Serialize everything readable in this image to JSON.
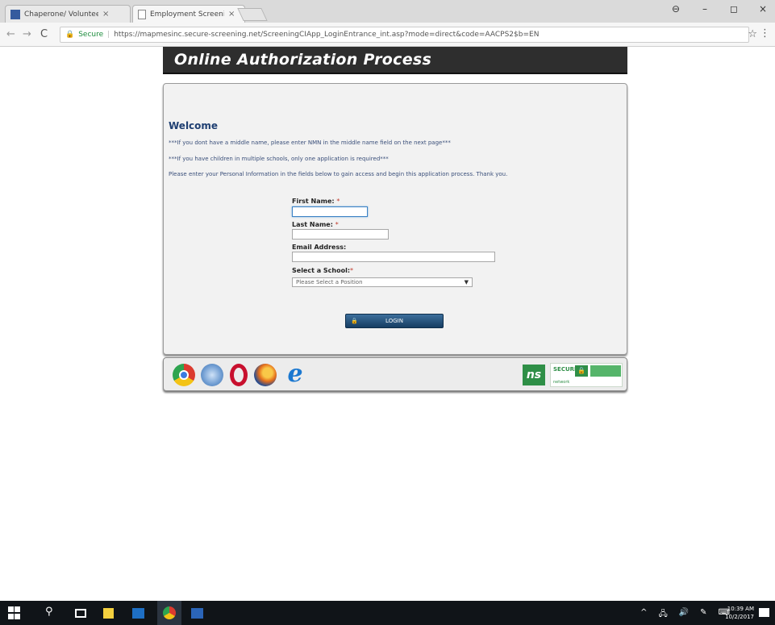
{
  "browser": {
    "tabs": [
      {
        "title": "Chaperone/ Volunteer S...",
        "close": "×"
      },
      {
        "title": "Employment Screening |",
        "close": "×"
      }
    ],
    "window_controls": {
      "profile": "⊖",
      "minimize": "–",
      "maximize": "◻",
      "close": "×"
    },
    "nav": {
      "back": "←",
      "forward": "→",
      "reload": "C"
    },
    "address": {
      "lock": "🔒",
      "secure_label": "Secure",
      "separator": "|",
      "url": "https://mapmesinc.secure-screening.net/ScreeningCIApp_LoginEntrance_int.asp?mode=direct&code=AACPS2$b=EN"
    },
    "star": "☆",
    "menu": "⋮"
  },
  "banner": {
    "title": "Online Authorization Process"
  },
  "form": {
    "welcome": "Welcome",
    "notes": [
      "***If you dont have a middle name, please enter NMN in the middle name field on the next page***",
      "***If you have children in multiple schools, only one application is required***",
      "Please enter your Personal Information in the fields below to gain access and begin this application process. Thank you."
    ],
    "first_name_label": "First Name:",
    "last_name_label": "Last Name:",
    "email_label": "Email Address:",
    "school_label": "Select a School:",
    "required_mark": "*",
    "first_name_value": "",
    "last_name_value": "",
    "email_value": "",
    "school_selected": "Please Select a Position",
    "select_arrow": "▼",
    "login_label": "LOGIN",
    "login_icon": "🔒"
  },
  "footer_icons": {
    "browsers": [
      "chrome-icon",
      "safari-icon",
      "opera-icon",
      "firefox-icon",
      "internet-explorer-icon"
    ],
    "ie_glyph": "e",
    "ns_logo": "ns",
    "secure_text": "SECURE",
    "secure_sub": "network"
  },
  "taskbar": {
    "search_glyph": "⚲",
    "tray": [
      "^",
      "🖧",
      "🔊",
      "✎",
      "⌨"
    ],
    "time": "10:39 AM",
    "date": "10/2/2017"
  }
}
